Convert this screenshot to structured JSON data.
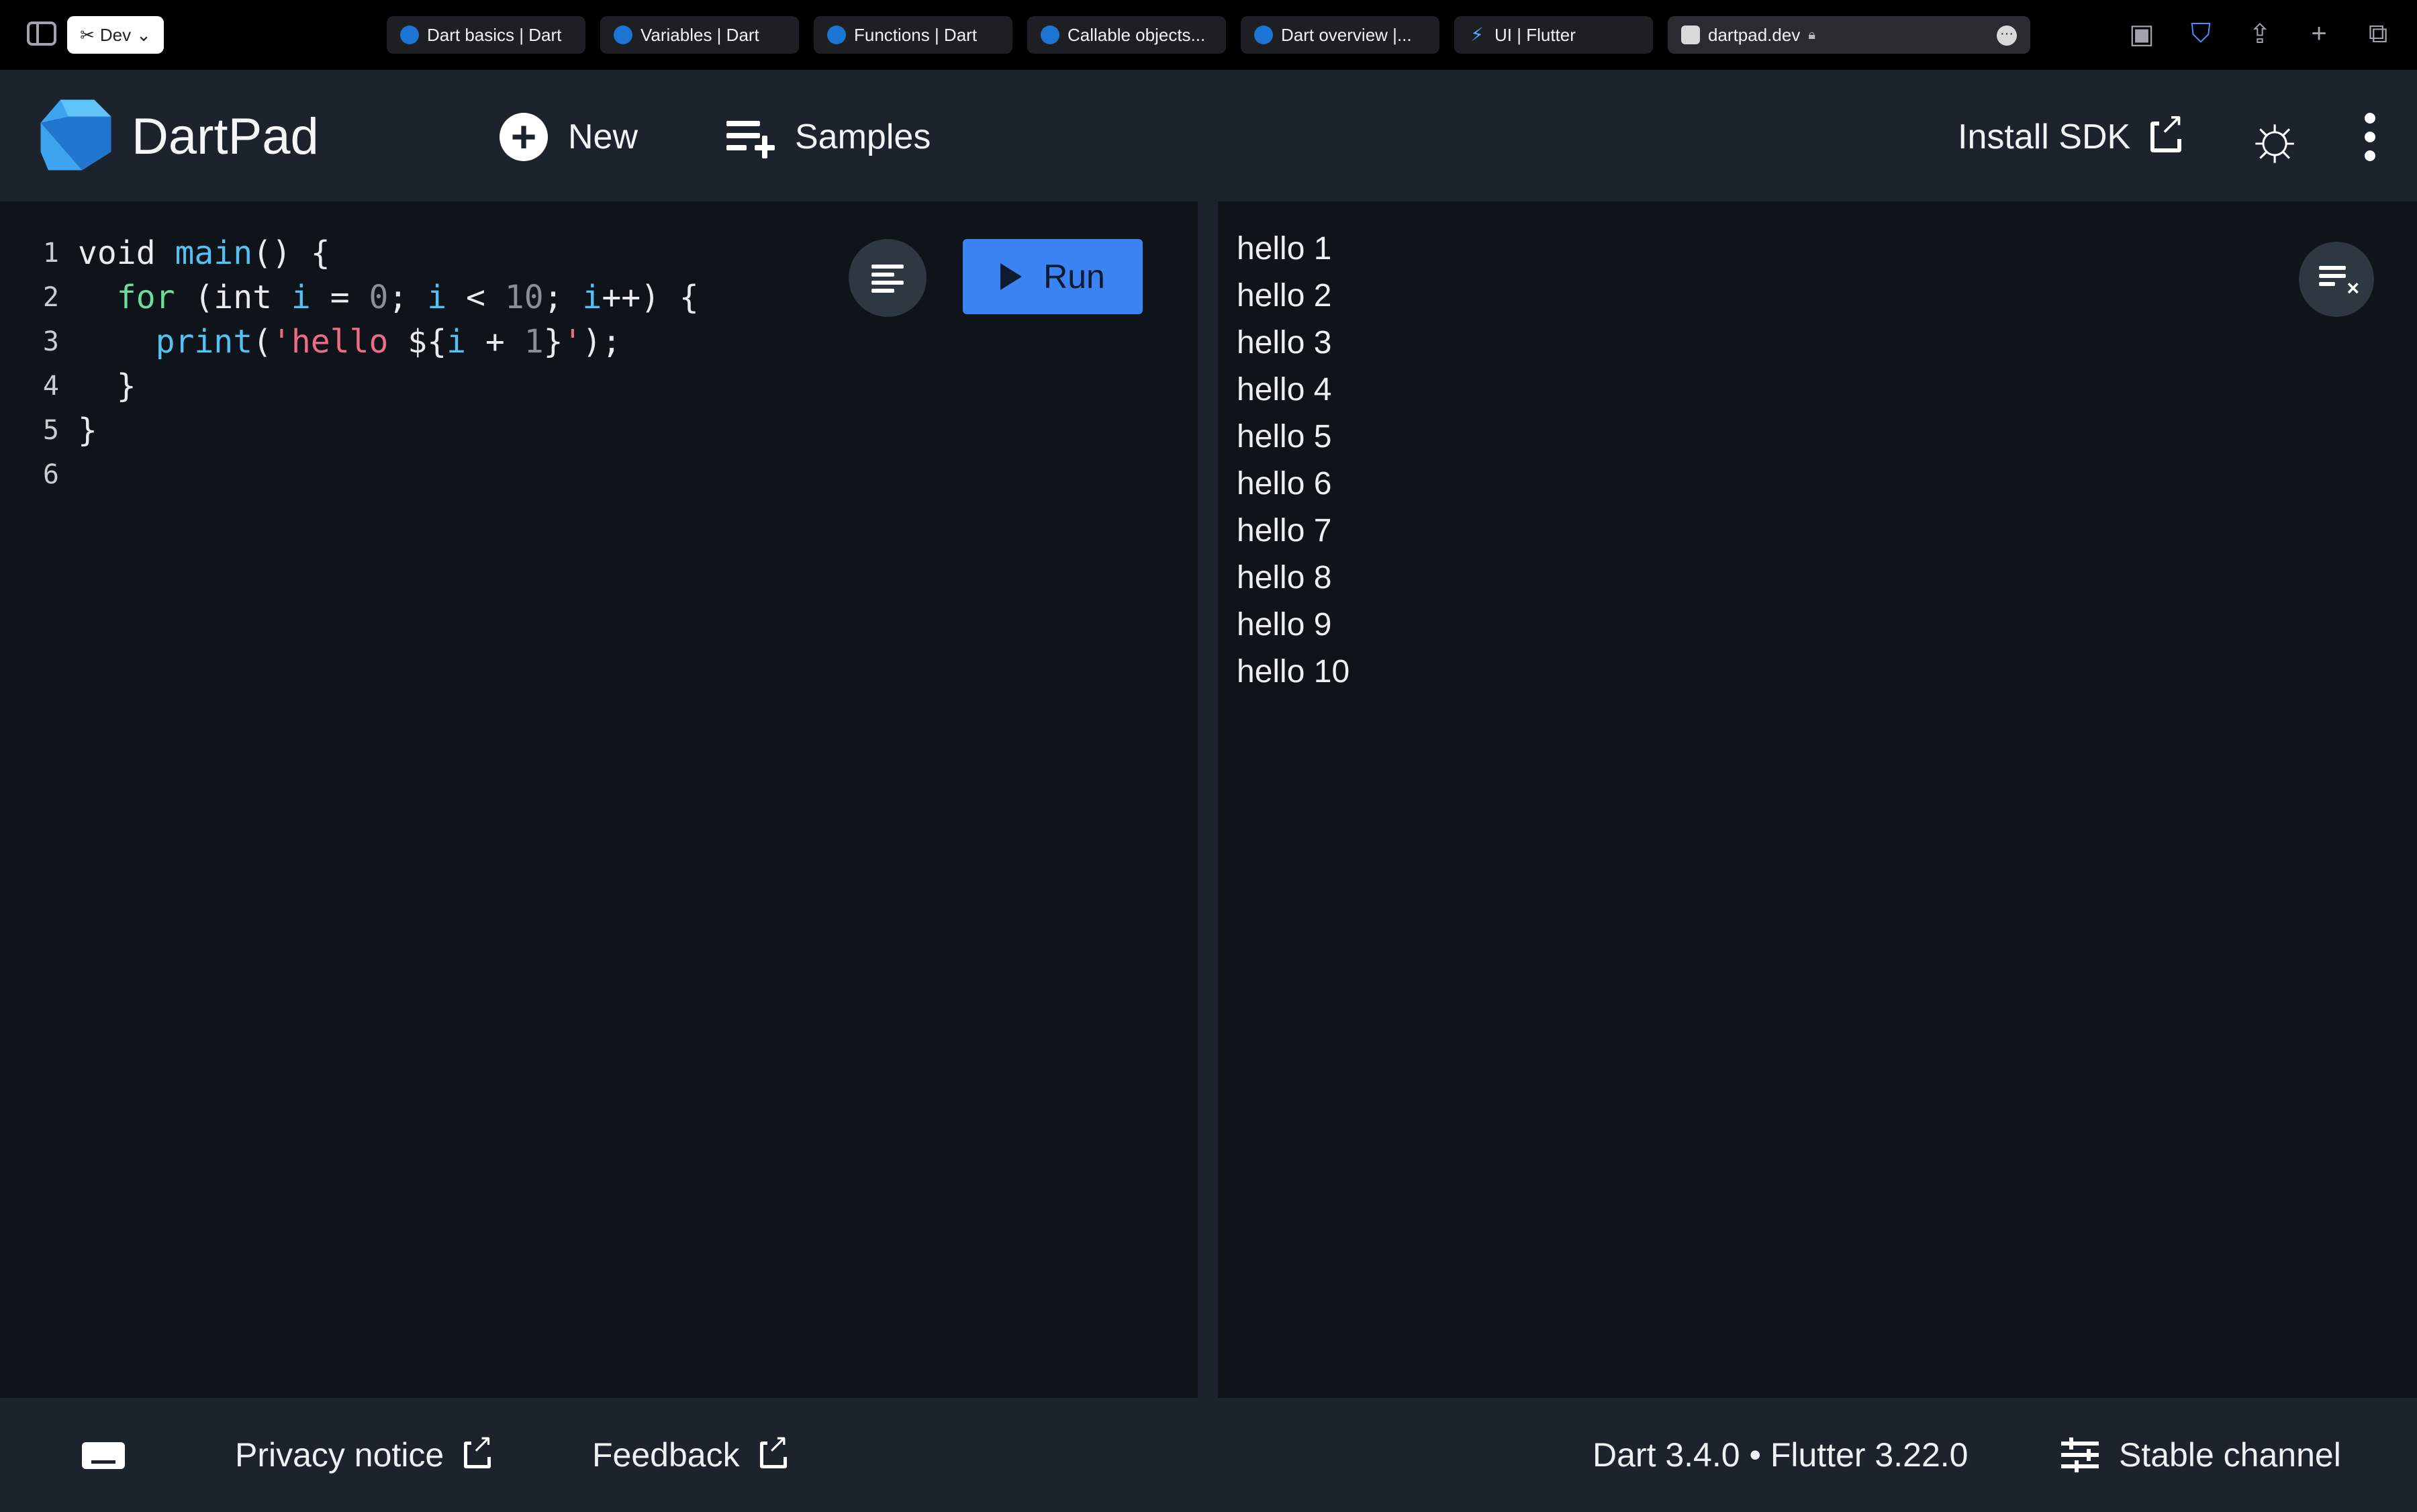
{
  "browser": {
    "profile_label": "Dev",
    "tabs": [
      {
        "label": "Dart basics | Dart"
      },
      {
        "label": "Variables | Dart"
      },
      {
        "label": "Functions | Dart"
      },
      {
        "label": "Callable objects..."
      },
      {
        "label": "Dart overview |..."
      },
      {
        "label": "UI | Flutter"
      }
    ],
    "active_tab": {
      "label": "dartpad.dev"
    }
  },
  "header": {
    "app_title": "DartPad",
    "new_label": "New",
    "samples_label": "Samples",
    "install_label": "Install SDK"
  },
  "editor": {
    "line_numbers": [
      "1",
      "2",
      "3",
      "4",
      "5",
      "6"
    ],
    "run_label": "Run"
  },
  "output": {
    "lines": [
      "hello 1",
      "hello 2",
      "hello 3",
      "hello 4",
      "hello 5",
      "hello 6",
      "hello 7",
      "hello 8",
      "hello 9",
      "hello 10"
    ]
  },
  "footer": {
    "privacy_label": "Privacy notice",
    "feedback_label": "Feedback",
    "version_label": "Dart 3.4.0 • Flutter 3.22.0",
    "channel_label": "Stable channel"
  },
  "colors": {
    "accent": "#3b82f2",
    "header_bg": "#1c232d",
    "editor_bg": "#0f141b"
  }
}
